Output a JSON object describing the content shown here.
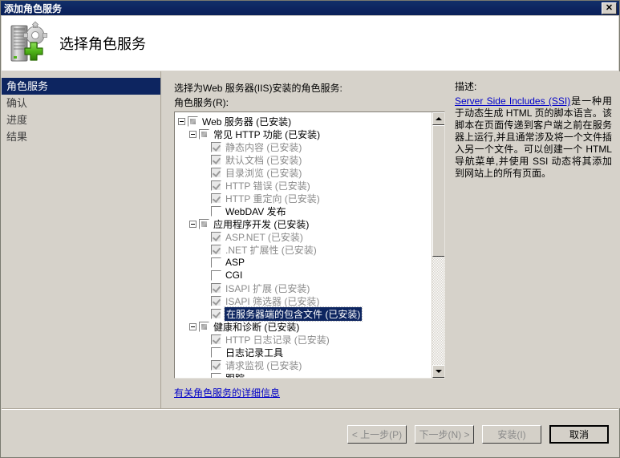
{
  "window": {
    "title": "添加角色服务",
    "close_label": "✕"
  },
  "header": {
    "title": "选择角色服务",
    "icon": "server-add-icon"
  },
  "sidebar": {
    "items": [
      {
        "label": "角色服务",
        "selected": true
      },
      {
        "label": "确认",
        "selected": false
      },
      {
        "label": "进度",
        "selected": false
      },
      {
        "label": "结果",
        "selected": false
      }
    ]
  },
  "main": {
    "instruction": "选择为Web 服务器(IIS)安装的角色服务:",
    "list_label": "角色服务(R):",
    "more_info_link": "有关角色服务的详细信息",
    "tree": [
      {
        "label": "Web 服务器 (已安装)",
        "indent": 1,
        "expander": true,
        "checkbox": "partial",
        "disabled": false,
        "selected": false
      },
      {
        "label": "常见 HTTP 功能 (已安装)",
        "indent": 2,
        "expander": true,
        "checkbox": "partial",
        "disabled": false,
        "selected": false
      },
      {
        "label": "静态内容 (已安装)",
        "indent": 3,
        "expander": false,
        "checkbox": "checked-gray",
        "disabled": true,
        "selected": false
      },
      {
        "label": "默认文档 (已安装)",
        "indent": 3,
        "expander": false,
        "checkbox": "checked-gray",
        "disabled": true,
        "selected": false
      },
      {
        "label": "目录浏览 (已安装)",
        "indent": 3,
        "expander": false,
        "checkbox": "checked-gray",
        "disabled": true,
        "selected": false
      },
      {
        "label": "HTTP 错误 (已安装)",
        "indent": 3,
        "expander": false,
        "checkbox": "checked-gray",
        "disabled": true,
        "selected": false
      },
      {
        "label": "HTTP 重定向 (已安装)",
        "indent": 3,
        "expander": false,
        "checkbox": "checked-gray",
        "disabled": true,
        "selected": false
      },
      {
        "label": "WebDAV 发布",
        "indent": 3,
        "expander": false,
        "checkbox": "empty",
        "disabled": false,
        "selected": false
      },
      {
        "label": "应用程序开发 (已安装)",
        "indent": 2,
        "expander": true,
        "checkbox": "partial",
        "disabled": false,
        "selected": false
      },
      {
        "label": "ASP.NET (已安装)",
        "indent": 3,
        "expander": false,
        "checkbox": "checked-gray",
        "disabled": true,
        "selected": false
      },
      {
        "label": ".NET 扩展性 (已安装)",
        "indent": 3,
        "expander": false,
        "checkbox": "checked-gray",
        "disabled": true,
        "selected": false
      },
      {
        "label": "ASP",
        "indent": 3,
        "expander": false,
        "checkbox": "empty",
        "disabled": false,
        "selected": false
      },
      {
        "label": "CGI",
        "indent": 3,
        "expander": false,
        "checkbox": "empty",
        "disabled": false,
        "selected": false
      },
      {
        "label": "ISAPI 扩展 (已安装)",
        "indent": 3,
        "expander": false,
        "checkbox": "checked-gray",
        "disabled": true,
        "selected": false
      },
      {
        "label": "ISAPI 筛选器 (已安装)",
        "indent": 3,
        "expander": false,
        "checkbox": "checked-gray",
        "disabled": true,
        "selected": false
      },
      {
        "label": "在服务器端的包含文件 (已安装)",
        "indent": 3,
        "expander": false,
        "checkbox": "checked-gray",
        "disabled": true,
        "selected": true
      },
      {
        "label": "健康和诊断 (已安装)",
        "indent": 2,
        "expander": true,
        "checkbox": "partial",
        "disabled": false,
        "selected": false
      },
      {
        "label": "HTTP 日志记录 (已安装)",
        "indent": 3,
        "expander": false,
        "checkbox": "checked-gray",
        "disabled": true,
        "selected": false
      },
      {
        "label": "日志记录工具",
        "indent": 3,
        "expander": false,
        "checkbox": "empty",
        "disabled": false,
        "selected": false
      },
      {
        "label": "请求监视 (已安装)",
        "indent": 3,
        "expander": false,
        "checkbox": "checked-gray",
        "disabled": true,
        "selected": false
      },
      {
        "label": "跟踪",
        "indent": 3,
        "expander": false,
        "checkbox": "empty",
        "disabled": false,
        "selected": false
      }
    ],
    "scrollbar": {
      "thumb_percent": 55
    }
  },
  "description": {
    "title": "描述:",
    "link_text": "Server Side Includes (SSI)",
    "body_text": "是一种用于动态生成 HTML 页的脚本语言。该脚本在页面传递到客户端之前在服务器上运行,并且通常涉及将一个文件插入另一个文件。可以创建一个 HTML 导航菜单,并使用 SSI 动态将其添加到网站上的所有页面。"
  },
  "footer": {
    "buttons": [
      {
        "label": "< 上一步(P)",
        "state": "disabled"
      },
      {
        "label": "下一步(N) >",
        "state": "disabled"
      },
      {
        "label": "安装(I)",
        "state": "disabled"
      },
      {
        "label": "取消",
        "state": "default"
      }
    ]
  },
  "colors": {
    "titlebar": "#0d2560",
    "selection": "#0d2560",
    "dialog_bg": "#d6d2ca",
    "link": "#0000c8"
  }
}
